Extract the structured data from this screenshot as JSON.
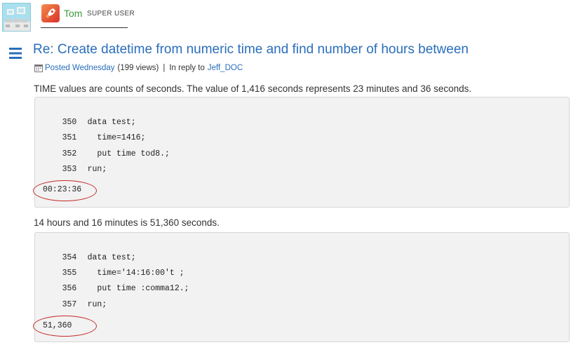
{
  "author": {
    "avatar_icon": "pixel-art-avatar-icon",
    "rank_icon": "rocket-rank-icon",
    "name": "Tom",
    "rank": "SUPER USER"
  },
  "post": {
    "menu_icon": "hamburger-menu-icon",
    "title": "Re: Create datetime from numeric time and find number of hours between",
    "meta": {
      "calendar_icon": "calendar-icon",
      "posted": "Posted Wednesday",
      "views": "(199 views)",
      "separator": "|",
      "reply_prefix": "In reply to",
      "reply_user": "Jeff_DOC"
    },
    "paragraph_1": "TIME values are counts of seconds.  The value of 1,416 seconds represents 23 minutes and 36 seconds.",
    "code_block_1": {
      "lines": [
        {
          "num": "350",
          "src": "data test;"
        },
        {
          "num": "351",
          "src": "  time=1416;"
        },
        {
          "num": "352",
          "src": "  put time tod8.;"
        },
        {
          "num": "353",
          "src": "run;"
        }
      ],
      "output": "00:23:36"
    },
    "paragraph_2": "14 hours and 16 minutes is 51,360 seconds.",
    "code_block_2": {
      "lines": [
        {
          "num": "354",
          "src": "data test;"
        },
        {
          "num": "355",
          "src": "  time='14:16:00't ;"
        },
        {
          "num": "356",
          "src": "  put time :comma12.;"
        },
        {
          "num": "357",
          "src": "run;"
        }
      ],
      "output": "51,360"
    }
  },
  "colors": {
    "link": "#2a6ebb",
    "author_name": "#3a9a3a",
    "highlight_oval": "#c42a2a",
    "code_background": "#f2f2f2"
  }
}
